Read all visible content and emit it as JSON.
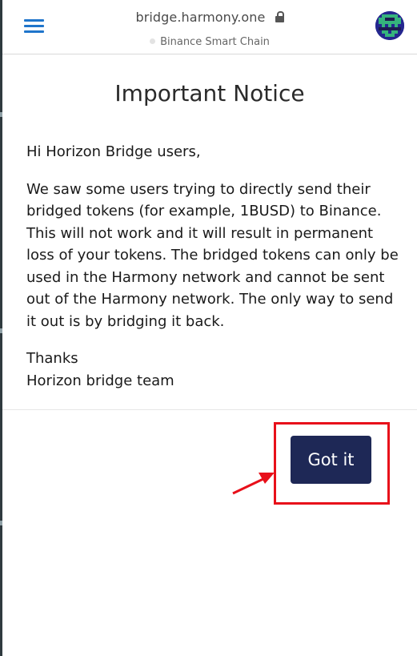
{
  "browser": {
    "url": "bridge.harmony.one",
    "network_label": "Binance Smart Chain"
  },
  "icons": {
    "menu": "hamburger-menu-icon",
    "lock": "lock-icon",
    "avatar": "pixel-avatar-icon"
  },
  "modal": {
    "title": "Important Notice",
    "greeting": "Hi Horizon Bridge users,",
    "message": "We saw some users trying to directly send their bridged tokens (for example, 1BUSD) to Binance. This will not work and it will result in permanent loss of your tokens. The bridged tokens can only be used in the Harmony network and cannot be sent out of the Harmony network. The only way to send it out is by bridging it back.",
    "thanks": "Thanks",
    "signature": "Horizon bridge team",
    "confirm_label": "Got it"
  },
  "colors": {
    "menu_icon": "#1f75cb",
    "button_bg": "#1e2856",
    "button_text": "#ffffff",
    "annotation": "#e8101a"
  }
}
